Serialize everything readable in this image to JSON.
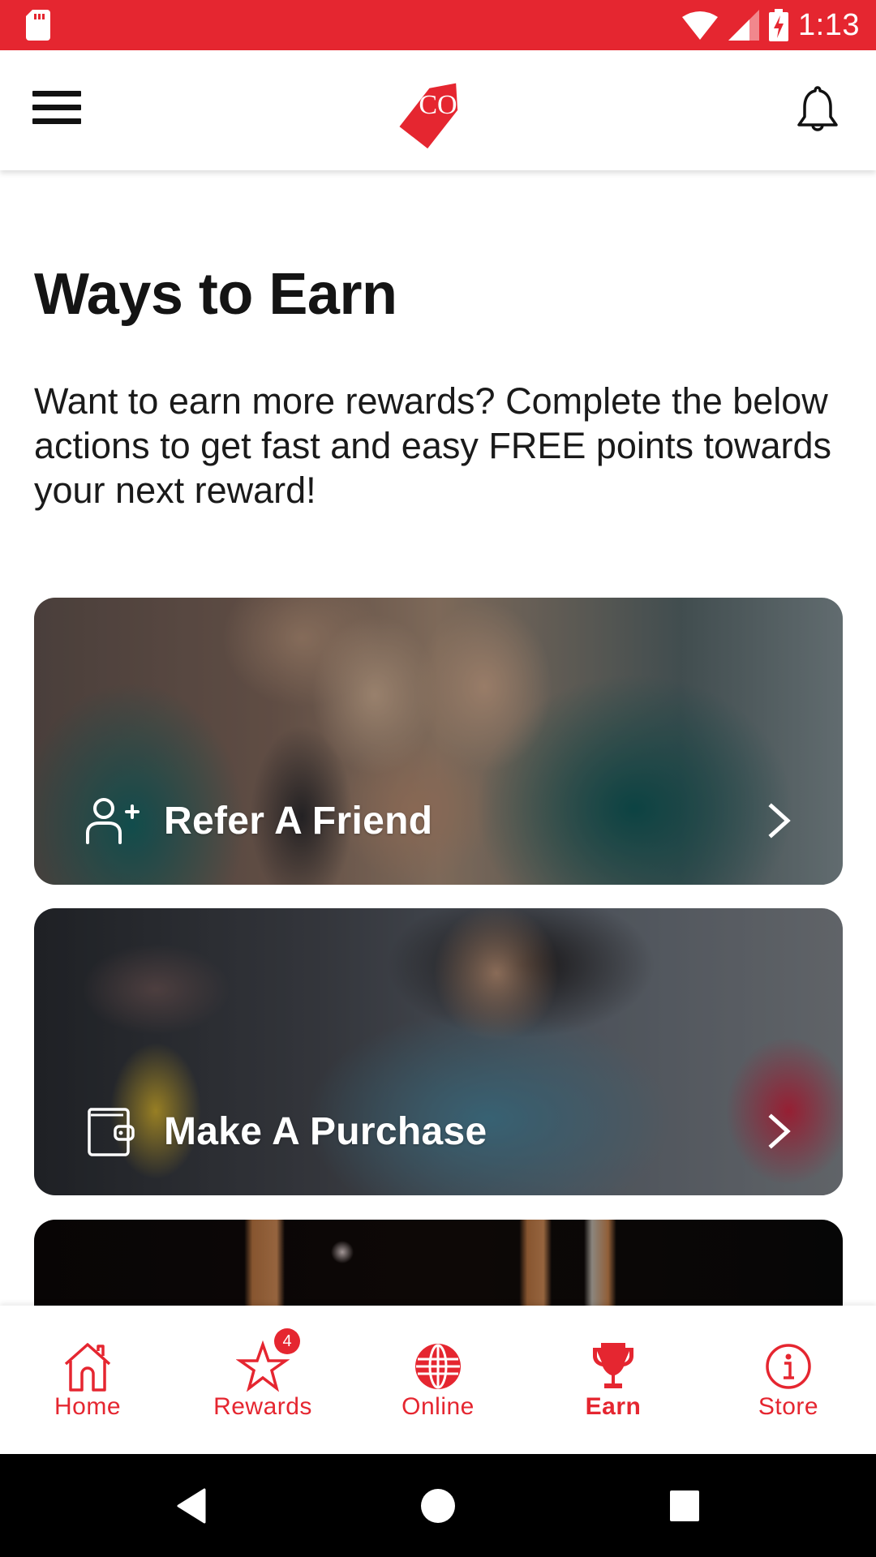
{
  "status_bar": {
    "time": "1:13",
    "icons": [
      "sd-card-icon",
      "wifi-icon",
      "cell-signal-icon",
      "battery-charging-icon"
    ]
  },
  "header": {
    "logo_text": "CO",
    "menu_icon": "hamburger-menu-icon",
    "notification_icon": "bell-icon"
  },
  "page": {
    "title": "Ways to Earn",
    "intro": "Want to earn more rewards? Complete the below actions to get fast and easy FREE points towards your next reward!"
  },
  "cards": [
    {
      "label": "Refer A Friend",
      "icon": "add-user-icon"
    },
    {
      "label": "Make A Purchase",
      "icon": "wallet-icon"
    },
    {
      "label": "",
      "icon": ""
    }
  ],
  "bottom_nav": {
    "items": [
      {
        "label": "Home",
        "icon": "home-icon",
        "active": false
      },
      {
        "label": "Rewards",
        "icon": "star-icon",
        "active": false,
        "badge": "4"
      },
      {
        "label": "Online",
        "icon": "globe-icon",
        "active": false
      },
      {
        "label": "Earn",
        "icon": "trophy-icon",
        "active": true
      },
      {
        "label": "Store",
        "icon": "info-icon",
        "active": false
      }
    ]
  },
  "system_nav": {
    "buttons": [
      "back-icon",
      "home-circle-icon",
      "recents-icon"
    ]
  },
  "colors": {
    "brand_red": "#e52630",
    "text_dark": "#141414",
    "white": "#ffffff"
  }
}
